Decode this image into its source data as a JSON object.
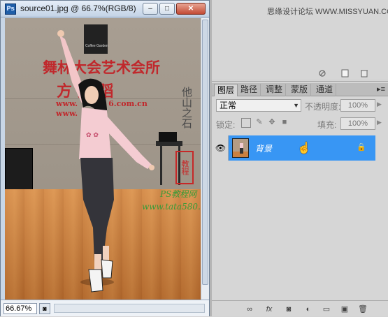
{
  "document": {
    "title": "source01.jpg @ 66.7%(RGB/8)",
    "ps_logo": "Ps",
    "window_buttons": {
      "minimize": "–",
      "maximize": "□",
      "close": "✕"
    },
    "zoom": "66.67%",
    "status_icon": "◙"
  },
  "photo": {
    "sign_line1": "舞林大会艺术会所",
    "sign_line2": "方  舞 蹈",
    "url_text": "www.    6.com.cn",
    "url_text2": "www.",
    "logo_text": "Coffee Garden",
    "vertical_watermark": "他山之石",
    "seal_text": "教程",
    "watermark1": "PS教程网",
    "watermark2": "www.tata580.com"
  },
  "top_panel": {
    "site_watermark": "思缘设计论坛 WWW.MISSYUAN.COM",
    "icons": [
      "no-icon",
      "new-icon",
      "trash-icon"
    ]
  },
  "layers_panel": {
    "tabs": [
      {
        "label": "图层",
        "active": true
      },
      {
        "label": "路径",
        "active": false
      },
      {
        "label": "调整",
        "active": false
      },
      {
        "label": "蒙版",
        "active": false
      },
      {
        "label": "通道",
        "active": false
      }
    ],
    "menu_icon": "▸≡",
    "blend_mode": "正常",
    "opacity_label": "不透明度:",
    "opacity_value": "100%",
    "lock_label": "锁定:",
    "fill_label": "填充:",
    "fill_value": "100%",
    "layer": {
      "name": "背景",
      "visible": true,
      "locked": true
    },
    "accent_color": "#3896f4"
  }
}
